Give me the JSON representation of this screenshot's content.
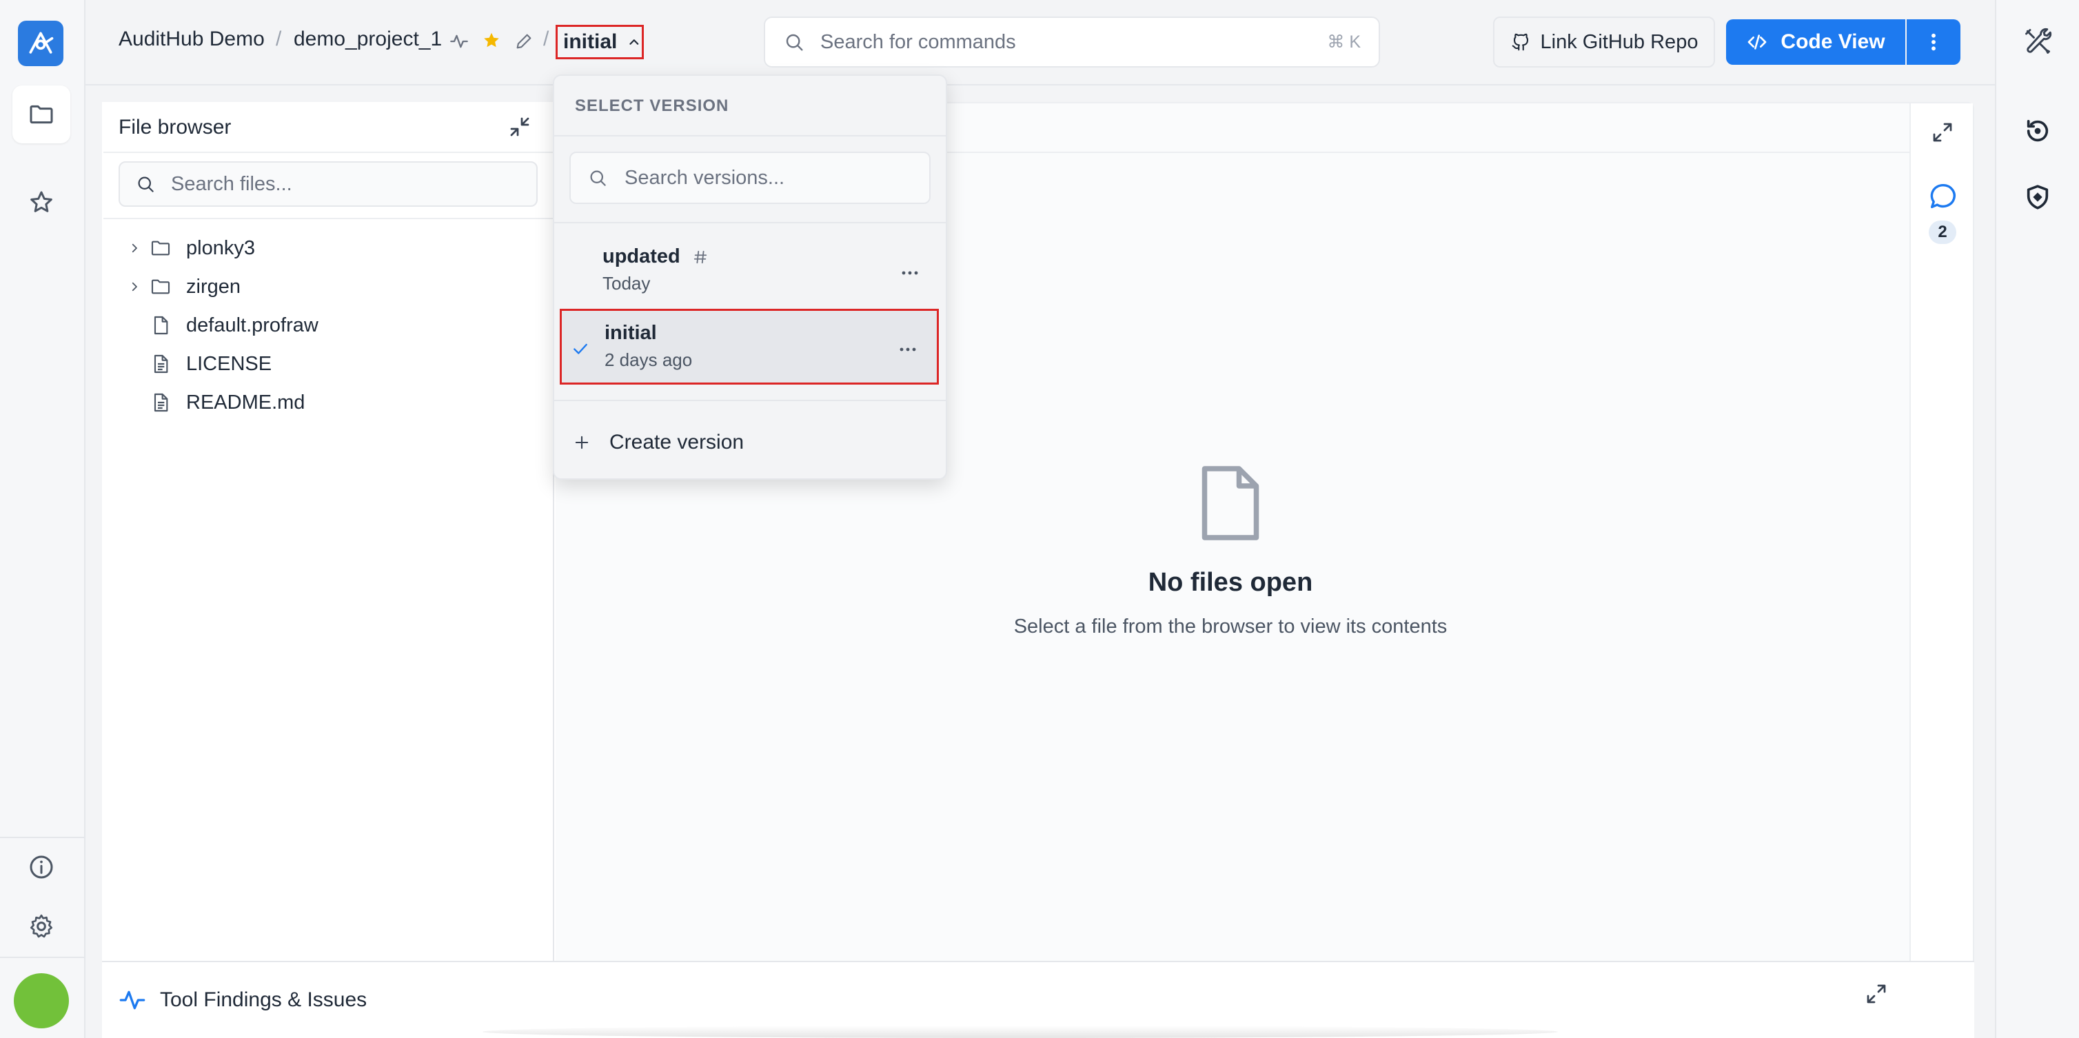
{
  "header": {
    "org": "AuditHub Demo",
    "project": "demo_project_1",
    "current_version": "initial",
    "command_search": {
      "placeholder": "Search for commands",
      "shortcut": "⌘ K"
    },
    "link_github_label": "Link GitHub Repo",
    "code_view_label": "Code View"
  },
  "file_browser": {
    "title": "File browser",
    "search_placeholder": "Search files...",
    "items": [
      {
        "name": "plonky3",
        "type": "folder"
      },
      {
        "name": "zirgen",
        "type": "folder"
      },
      {
        "name": "default.profraw",
        "type": "file"
      },
      {
        "name": "LICENSE",
        "type": "text-file"
      },
      {
        "name": "README.md",
        "type": "text-file"
      }
    ]
  },
  "editor": {
    "empty_title": "No files open",
    "empty_subtitle": "Select a file from the browser to view its contents",
    "comment_count": "2"
  },
  "bottom_bar": {
    "label": "Tool Findings & Issues"
  },
  "version_dropdown": {
    "header": "SELECT VERSION",
    "search_placeholder": "Search versions...",
    "versions": [
      {
        "name": "updated",
        "date": "Today",
        "selected": false
      },
      {
        "name": "initial",
        "date": "2 days ago",
        "selected": true
      }
    ],
    "create_label": "Create version"
  },
  "colors": {
    "accent": "#1d7af0",
    "highlight": "#dc2626",
    "star": "#f5b800",
    "avatar": "#72c13a"
  }
}
